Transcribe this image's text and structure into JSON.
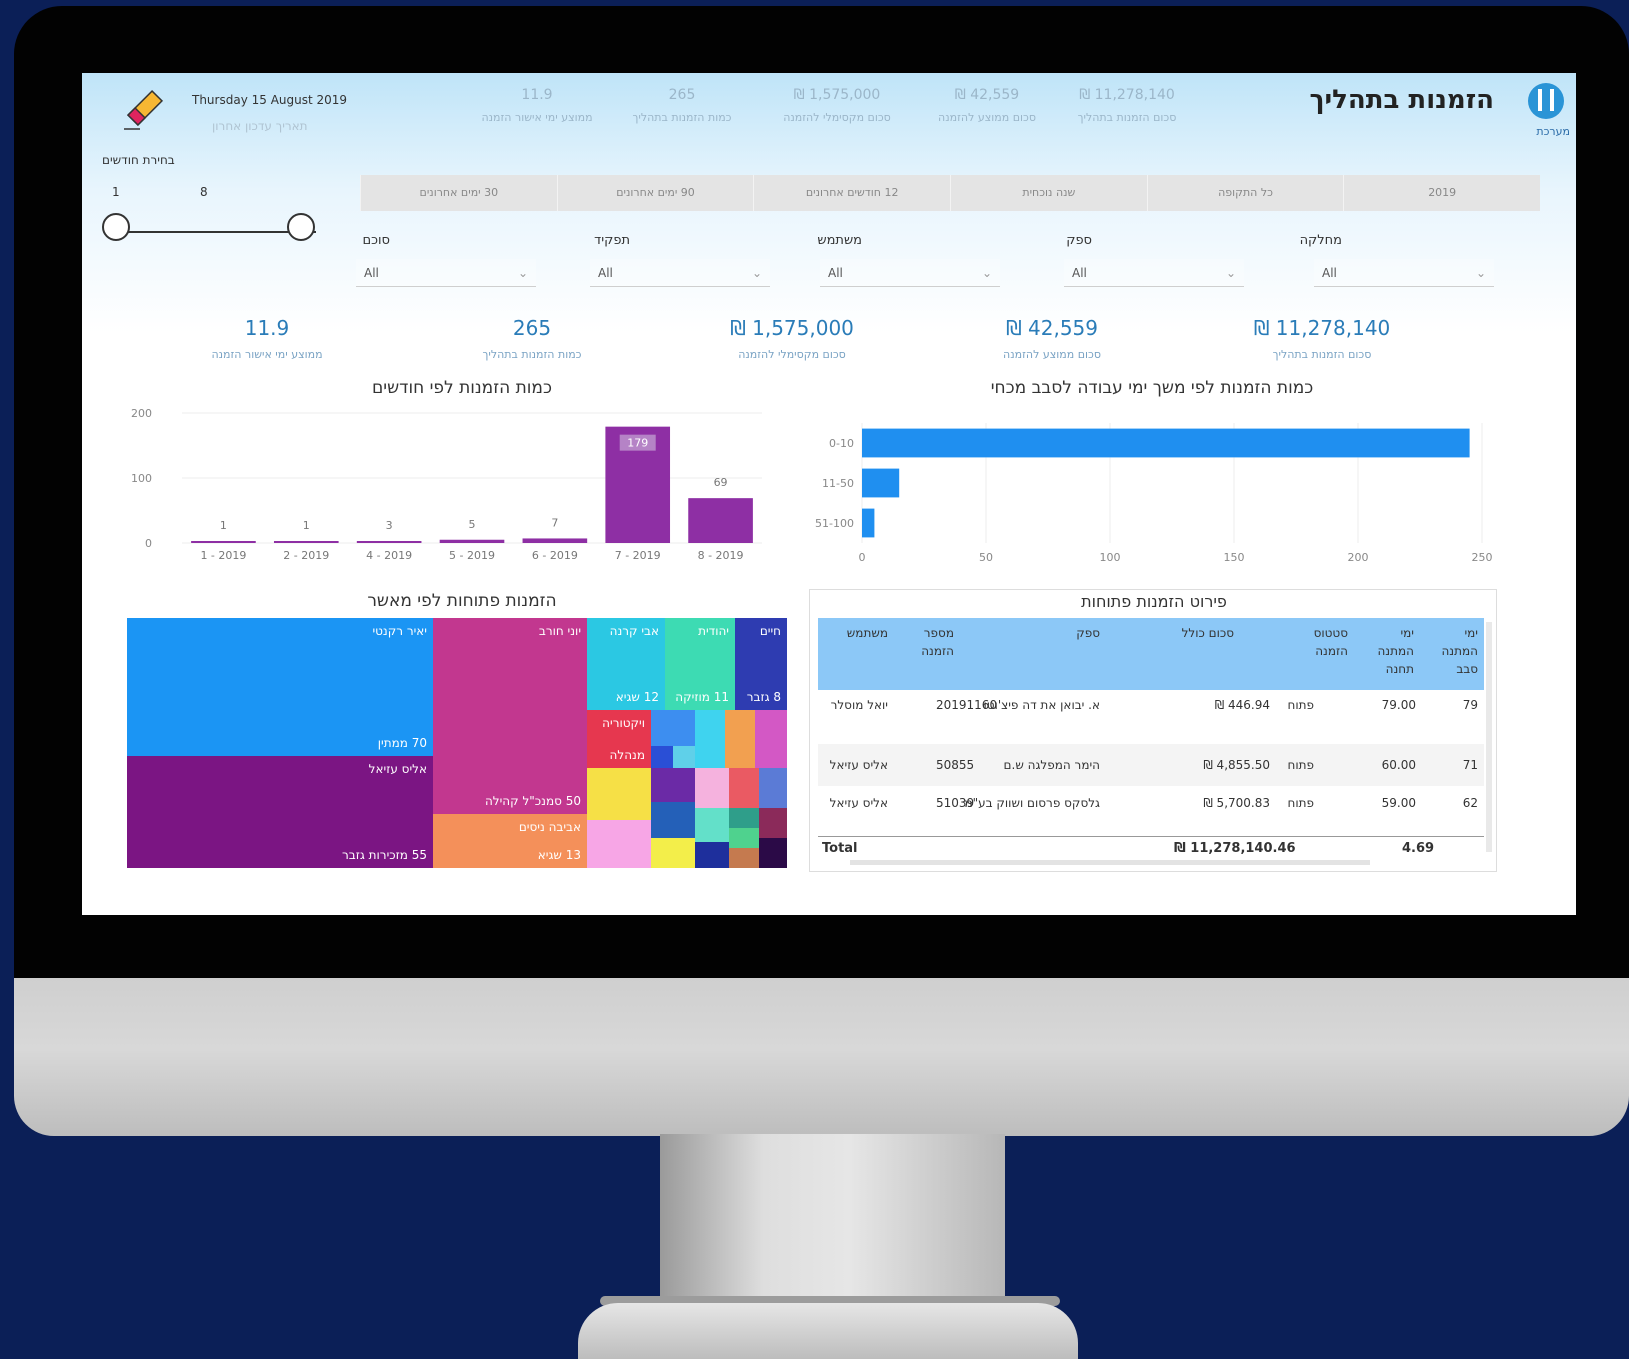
{
  "header": {
    "title": "הזמנות בתהליך",
    "logo_text": "מערכת",
    "date": "Thursday 15 August 2019",
    "date_caption": "תאריך עדכון אחרון"
  },
  "top_kpis": [
    {
      "value": "₪ 11,278,140",
      "label": "סכום הזמנות בתהליך"
    },
    {
      "value": "₪ 42,559",
      "label": "סכום ממוצע להזמנה"
    },
    {
      "value": "₪ 1,575,000",
      "label": "סכום מקסימלי להזמנה"
    },
    {
      "value": "265",
      "label": "כמות הזמנות בתהליך"
    },
    {
      "value": "11.9",
      "label": "ממוצע ימי אישור הזמנה"
    }
  ],
  "slider": {
    "label": "בחירת חודשים",
    "min": "1",
    "max": "8"
  },
  "tabs": [
    "2019",
    "כל התקופה",
    "שנה נוכחית",
    "12 חודשים אחרונים",
    "90 ימים אחרונים",
    "30 ימים אחרונים"
  ],
  "filters": [
    {
      "label": "מחלקה",
      "value": "All"
    },
    {
      "label": "ספק",
      "value": "All"
    },
    {
      "label": "משתמש",
      "value": "All"
    },
    {
      "label": "תפקיד",
      "value": "All"
    },
    {
      "label": "סוכם",
      "value": "All"
    }
  ],
  "kpis": [
    {
      "value": "₪ 11,278,140",
      "label": "סכום הזמנות בתהליך"
    },
    {
      "value": "₪ 42,559",
      "label": "סכום ממוצע להזמנה"
    },
    {
      "value": "₪ 1,575,000",
      "label": "סכום מקסימלי להזמנה"
    },
    {
      "value": "265",
      "label": "כמות הזמנות בתהליך"
    },
    {
      "value": "11.9",
      "label": "ממוצע ימי אישור הזמנה"
    }
  ],
  "chart_titles": {
    "months": "כמות הזמנות לפי חודשים",
    "duration": "כמות הזמנות לפי משך ימי עבודה לסבב מכחי",
    "treemap": "הזמנות פתוחות לפי מאשר",
    "table": "פירוט הזמנות פתוחות"
  },
  "chart_data": [
    {
      "type": "bar",
      "title": "כמות הזמנות לפי חודשים",
      "categories": [
        "1 - 2019",
        "2 - 2019",
        "4 - 2019",
        "5 - 2019",
        "6 - 2019",
        "7 - 2019",
        "8 - 2019"
      ],
      "values": [
        1,
        1,
        3,
        5,
        7,
        179,
        69
      ],
      "ylim": [
        0,
        200
      ],
      "yticks": [
        0,
        100,
        200
      ],
      "color": "#8e2fa4"
    },
    {
      "type": "bar",
      "orientation": "horizontal",
      "title": "כמות הזמנות לפי משך ימי עבודה לסבב מכחי",
      "categories": [
        "0-10",
        "11-50",
        "51-100"
      ],
      "values": [
        245,
        15,
        5
      ],
      "xlim": [
        0,
        250
      ],
      "xticks": [
        0,
        50,
        100,
        150,
        200,
        250
      ],
      "color": "#1f8ff0"
    }
  ],
  "treemap": [
    {
      "name": "יאיר רקנטי",
      "count": "70 ממתין",
      "color": "#1b95f4"
    },
    {
      "name": "אליס עזיאל",
      "count": "55 מזכירות גזבר",
      "color": "#7b1583"
    },
    {
      "name": "יוני חורב",
      "count": "50 סמנכ\"ל קהילה",
      "color": "#c2378f"
    },
    {
      "name": "אביבה ניסים",
      "count": "13 שגיא",
      "color": "#f4905a"
    },
    {
      "name": "אבי קרנה",
      "count": "12 שגיא",
      "color": "#2bc8e3"
    },
    {
      "name": "יהודית",
      "count": "11 מוזיקה",
      "color": "#3ddbb3"
    },
    {
      "name": "חיים",
      "count": "8 גזבר",
      "color": "#2e3cb1"
    },
    {
      "name": "ויקטוריה",
      "count": "מנהלה",
      "color": "#e6374f"
    }
  ],
  "table": {
    "headers": [
      "משתמש",
      "מספר הזמנה",
      "ספק",
      "סכום כולל",
      "סטטוס הזמנה",
      "ימי המתנה תחנה",
      "ימי המתנה סבב"
    ],
    "rows": [
      {
        "user": "יואל מוסלר",
        "order": "20191160",
        "supplier": "א. יבואן את דה פיצ'וטו",
        "amount": "₪ 446.94",
        "status": "פתוח",
        "wait_station": "79.00",
        "wait_cycle": "79"
      },
      {
        "user": "אליס עזיאל",
        "order": "50855",
        "supplier": "הימר המפלגה ש.ם",
        "amount": "₪ 4,855.50",
        "status": "פתוח",
        "wait_station": "60.00",
        "wait_cycle": "71"
      },
      {
        "user": "אליס עזיאל",
        "order": "51039",
        "supplier": "גלסקס פרסום ושווק בע\"מ",
        "amount": "₪ 5,700.83",
        "status": "פתוח",
        "wait_station": "59.00",
        "wait_cycle": "62"
      }
    ],
    "total_label": "Total",
    "total_amount": "₪ 11,278,140.46",
    "total_wait": "4.69"
  }
}
